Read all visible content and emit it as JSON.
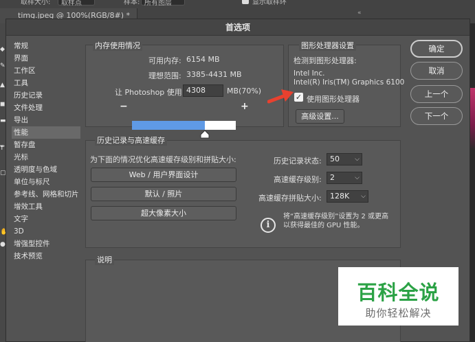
{
  "background": {
    "options_bar": {
      "sample_size_label": "取样大小:",
      "sample_size_value": "取样点",
      "sample_label": "样本:",
      "sample_value": "所有图层",
      "show_ring_label": "显示取样环"
    },
    "doc_tab": "timg.jpeg @ 100%(RGB/8#) *",
    "tool_letter_t": "T"
  },
  "dialog": {
    "title": "首选项",
    "nav_items": [
      "常规",
      "界面",
      "工作区",
      "工具",
      "历史记录",
      "文件处理",
      "导出",
      "性能",
      "暂存盘",
      "光标",
      "透明度与色域",
      "单位与标尺",
      "参考线、网格和切片",
      "增效工具",
      "文字",
      "3D",
      "增强型控件",
      "技术预览"
    ],
    "active_nav_index": 7,
    "memory": {
      "legend": "内存使用情况",
      "available_label": "可用内存:",
      "available_value": "6154 MB",
      "ideal_label": "理想范围:",
      "ideal_value": "3385-4431 MB",
      "let_label": "让 Photoshop 使用:",
      "let_value": "4308",
      "let_suffix": "MB(70%)",
      "minus": "−",
      "plus": "+",
      "usage_fraction": 0.7
    },
    "gpu": {
      "legend": "图形处理器设置",
      "detected_label": "检测到图形处理器:",
      "vendor": "Intel Inc.",
      "model": "Intel(R) Iris(TM) Graphics 6100",
      "use_gpu_label": "使用图形处理器",
      "use_gpu_checked": true,
      "advanced_button": "高级设置..."
    },
    "history": {
      "legend": "历史记录与高速缓存",
      "optimize_label": "为下面的情况优化高速缓存级别和拼贴大小:",
      "preset_buttons": [
        "Web / 用户界面设计",
        "默认 / 照片",
        "超大像素大小"
      ],
      "history_states_label": "历史记录状态:",
      "history_states_value": "50",
      "cache_levels_label": "高速缓存级别:",
      "cache_levels_value": "2",
      "tile_size_label": "高速缓存拼贴大小:",
      "tile_size_value": "128K",
      "info_line1": "将“高速缓存级别”设置为 2 或更高",
      "info_line2": "以获得最佳的 GPU 性能。",
      "info_icon": "i"
    },
    "description": {
      "legend": "说明"
    },
    "buttons": {
      "ok": "确定",
      "cancel": "取消",
      "prev": "上一个",
      "next": "下一个"
    }
  },
  "watermark": {
    "title": "百科全说",
    "subtitle": "助你轻松解决"
  },
  "colors": {
    "dialog_bg": "#535353",
    "accent_blue": "#5f9ae6",
    "arrow_red": "#e8412f",
    "watermark_green": "#2ba245"
  }
}
